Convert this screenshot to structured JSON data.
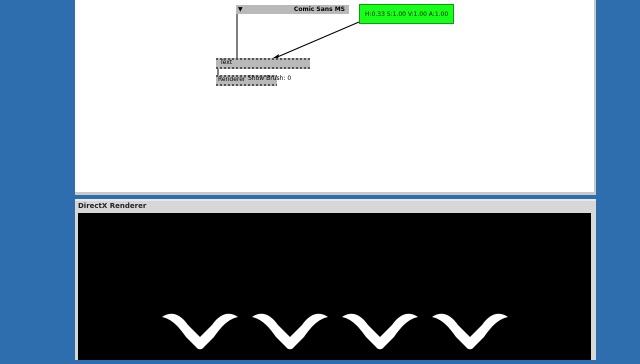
{
  "patch": {
    "font_node": {
      "dropdown_glyph": "▼",
      "value": "Comic Sans MS"
    },
    "color_node": {
      "text": "H:0.33  S:1.00  V:1.00  A:1.00",
      "color": "#19ff19"
    },
    "text_node": {
      "label": "Text"
    },
    "renderer_node": {
      "label": "Renderer"
    },
    "show_brush": {
      "text": "Show Brush: 0"
    }
  },
  "renderer_window": {
    "title": "DirectX Renderer",
    "render_text": "VVVV",
    "background": "#000000",
    "glyph_color": "#ffffff"
  }
}
